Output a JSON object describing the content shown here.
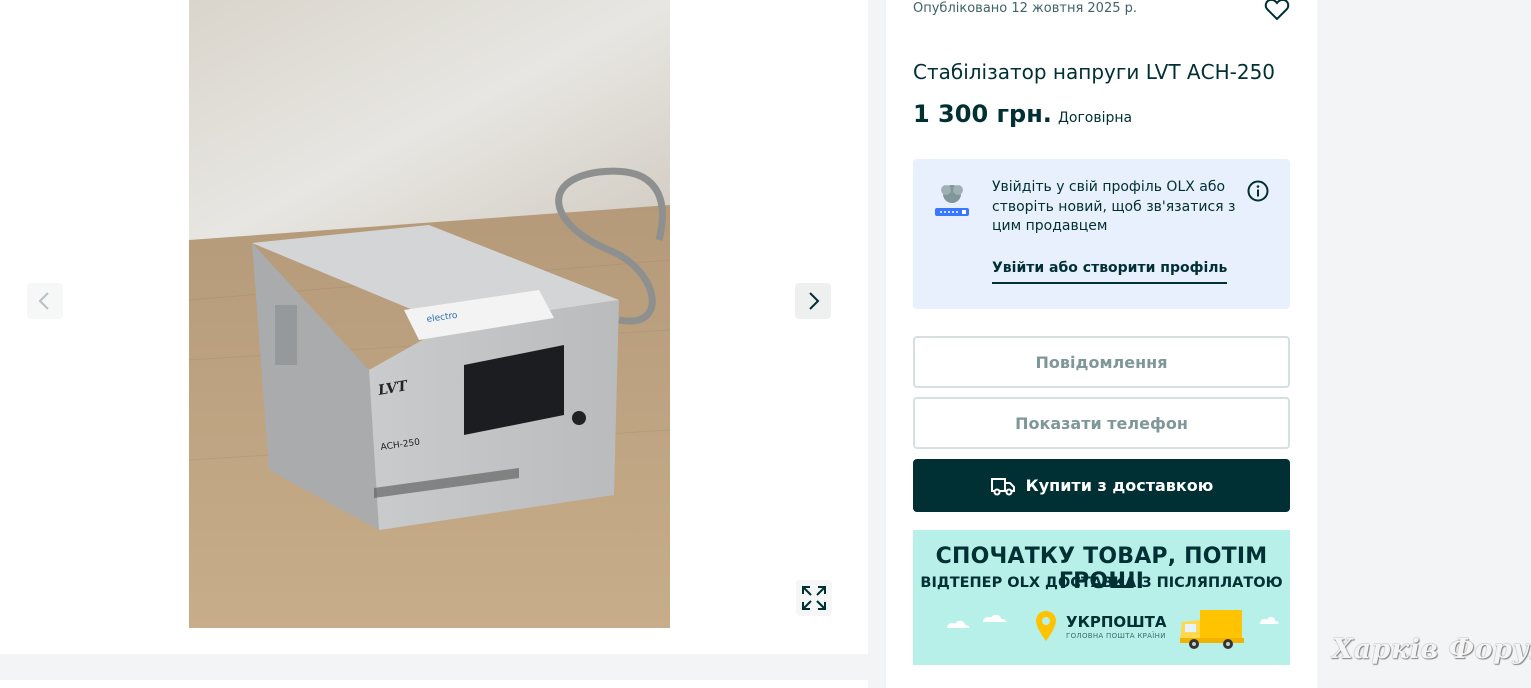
{
  "listing": {
    "published": "Опубліковано 12 жовтня 2025 р.",
    "title": "Стабілізатор напруги LVT АСН-250",
    "price": "1 300 грн.",
    "price_note": "Договірна"
  },
  "gallery": {
    "prev_icon": "chevron-left-icon",
    "next_icon": "chevron-right-icon",
    "expand_icon": "expand-icon",
    "device_brand": "LVT",
    "device_model": "АСН-250"
  },
  "login_prompt": {
    "text": "Увійдіть у свій профіль OLX або створіть новий, щоб зв'язатися з цим продавцем",
    "link": "Увійти або створити профіль"
  },
  "actions": {
    "message": "Повідомлення",
    "phone": "Показати телефон",
    "buy": "Купити з доставкою"
  },
  "promo": {
    "line1": "СПОЧАТКУ ТОВАР, ПОТІМ ГРОШІ",
    "line2": "ВІДТЕПЕР OLX ДОСТАВКА З ПІСЛЯПЛАТОЮ",
    "brand": "УКРПОШТА",
    "brand_sub": "ГОЛОВНА ПОШТА КРАЇНИ"
  },
  "watermark": "Харків Форум",
  "colors": {
    "primary": "#002f34",
    "login_bg": "#e8f0fd",
    "promo_bg": "#b7f0e8",
    "ukrposhta_yellow": "#ffc300"
  }
}
